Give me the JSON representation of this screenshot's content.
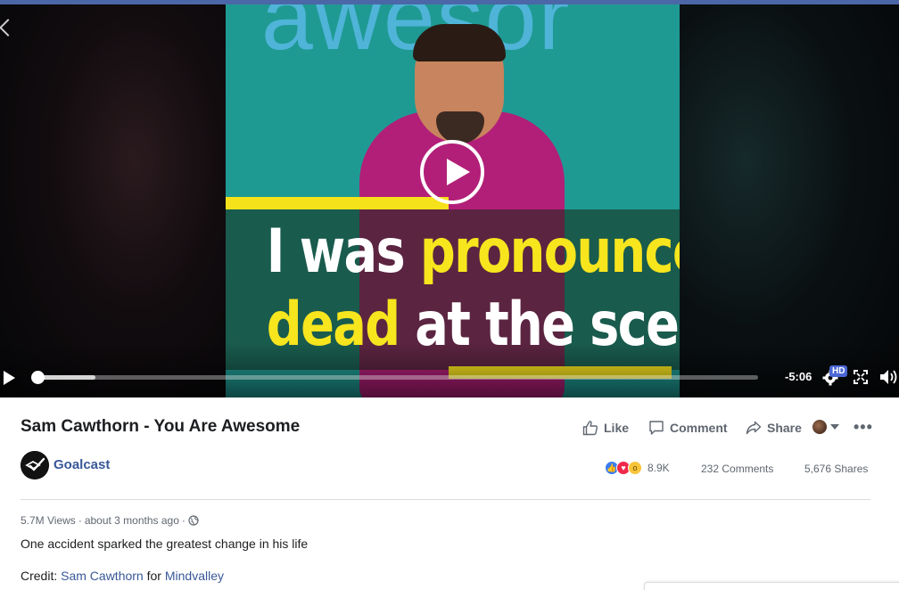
{
  "colors": {
    "topbar": "#4b67a8",
    "link": "#385898",
    "caption_yellow": "#f7e51e",
    "shirt_magenta": "#b21f78",
    "backdrop_teal": "#1f9a93"
  },
  "player": {
    "frame_caption": {
      "line1_white": "I was",
      "line1_yellow": "pronounced",
      "line2_yellow": "dead",
      "line2_white": "at the scene"
    },
    "time_remaining": "-5:06",
    "quality_badge": "HD",
    "progress_fraction": 0.0,
    "buffered_fraction": 0.08
  },
  "post": {
    "title": "Sam Cawthorn - You Are Awesome",
    "actions": {
      "like": "Like",
      "comment": "Comment",
      "share": "Share"
    },
    "page_name": "Goalcast",
    "reaction_count": "8.9K",
    "comments_count": "232 Comments",
    "shares_count": "5,676 Shares",
    "views": "5.7M Views",
    "separator": "·",
    "posted": "about 3 months ago",
    "description": "One accident sparked the greatest change in his life",
    "credit": {
      "prefix": "Credit:",
      "person": "Sam Cawthorn",
      "joiner": "for",
      "org": "Mindvalley"
    }
  }
}
